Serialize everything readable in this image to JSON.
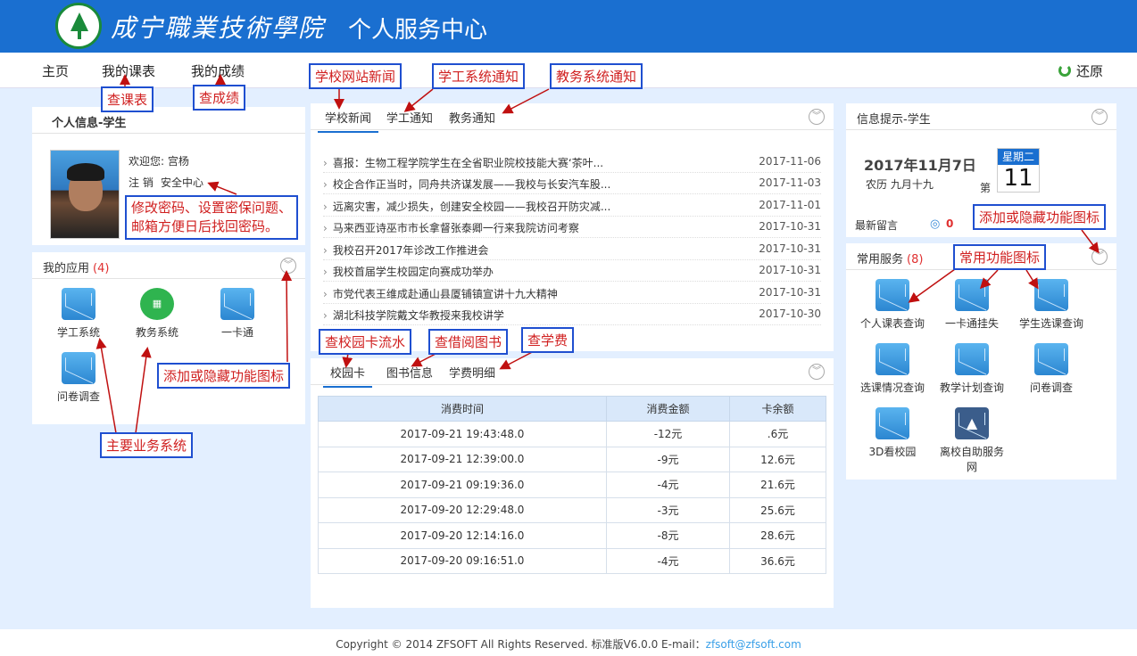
{
  "header": {
    "school": "成宁職業技術學院",
    "center": "个人服务中心"
  },
  "nav": {
    "home": "主页",
    "courses": "我的课表",
    "grades": "我的成绩",
    "restore": "还原"
  },
  "profile": {
    "title": "个人信息-学生",
    "welcome": "欢迎您: 宫杨",
    "logout": "注 销",
    "security": "安全中心"
  },
  "apps": {
    "title": "我的应用",
    "count": "(4)",
    "items": [
      "学工系统",
      "教务系统",
      "一卡通",
      "问卷调查"
    ]
  },
  "news": {
    "tabs": [
      "学校新闻",
      "学工通知",
      "教务通知"
    ],
    "rows": [
      {
        "title": "喜报：生物工程学院学生在全省职业院校技能大赛‘茶叶...",
        "date": "2017-11-06"
      },
      {
        "title": "校企合作正当时，同舟共济谋发展——我校与长安汽车股...",
        "date": "2017-11-03"
      },
      {
        "title": "远离灾害，减少损失，创建安全校园——我校召开防灾减...",
        "date": "2017-11-01"
      },
      {
        "title": "马来西亚诗巫市市长拿督张泰卿一行来我院访问考察",
        "date": "2017-10-31"
      },
      {
        "title": "我校召开2017年诊改工作推进会",
        "date": "2017-10-31"
      },
      {
        "title": "我校首届学生校园定向赛成功举办",
        "date": "2017-10-31"
      },
      {
        "title": "市党代表王维成赴通山县厦铺镇宣讲十九大精神",
        "date": "2017-10-31"
      },
      {
        "title": "湖北科技学院戴文华教授来我校讲学",
        "date": "2017-10-30"
      }
    ]
  },
  "card": {
    "tabs": [
      "校园卡",
      "图书信息",
      "学费明细"
    ],
    "headers": [
      "消费时间",
      "消费金额",
      "卡余额"
    ],
    "rows": [
      [
        "2017-09-21 19:43:48.0",
        "-12元",
        ".6元"
      ],
      [
        "2017-09-21 12:39:00.0",
        "-9元",
        "12.6元"
      ],
      [
        "2017-09-21 09:19:36.0",
        "-4元",
        "21.6元"
      ],
      [
        "2017-09-20 12:29:48.0",
        "-3元",
        "25.6元"
      ],
      [
        "2017-09-20 12:14:16.0",
        "-8元",
        "28.6元"
      ],
      [
        "2017-09-20 09:16:51.0",
        "-4元",
        "36.6元"
      ]
    ]
  },
  "info": {
    "title": "信息提示-学生",
    "date": "2017年11月7日",
    "lunar": "农历 九月十九",
    "week_prefix": "第",
    "weekday": "星期二",
    "week_num": "11",
    "messages": "最新留言",
    "msg_count": "0"
  },
  "services": {
    "title": "常用服务",
    "count": "(8)",
    "items": [
      "个人课表查询",
      "一卡通挂失",
      "学生选课查询",
      "选课情况查询",
      "教学计划查询",
      "问卷调查",
      "3D看校园",
      "离校自助服务网"
    ]
  },
  "annotations": {
    "chakebiao": "查课表",
    "chachengji": "查成绩",
    "news": "学校网站新闻",
    "xuegong": "学工系统通知",
    "jiaowu": "教务系统通知",
    "password_l1": "修改密码、设置密保问题、",
    "password_l2": "邮箱方便日后找回密码。",
    "toggle_apps": "添加或隐藏功能图标",
    "main_sys": "主要业务系统",
    "card_flow": "查校园卡流水",
    "library": "查借阅图书",
    "tuition": "查学费",
    "toggle_info": "添加或隐藏功能图标",
    "common_icons": "常用功能图标"
  },
  "footer": {
    "copyright": "Copyright © 2014 ZFSOFT All Rights Reserved. 标准版V6.0.0   E-mail：",
    "email": "zfsoft@zfsoft.com"
  },
  "colors": {
    "brand": "#1a6fd0",
    "annotation_border": "#1f4fd0",
    "annotation_text": "#d02020"
  }
}
